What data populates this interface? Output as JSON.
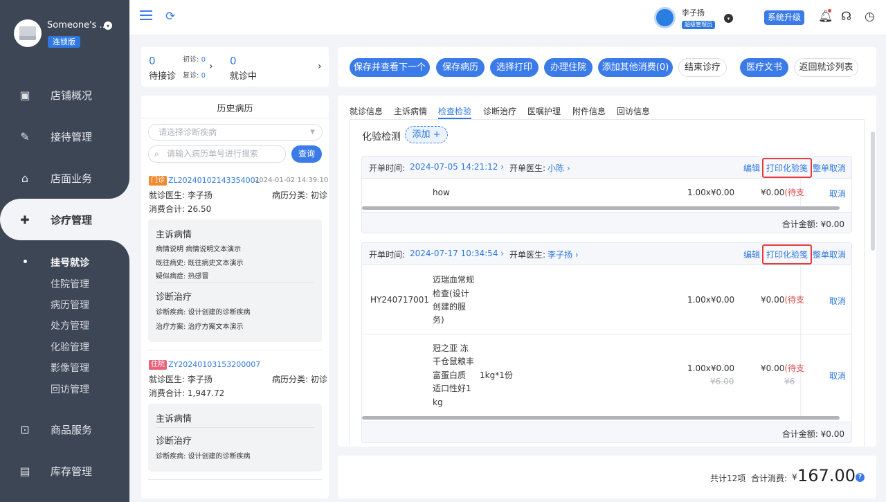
{
  "shop": {
    "name": "Someone's ...",
    "badge": "连锁版"
  },
  "nav": [
    {
      "label": "店铺概况",
      "icon": "monitor-icon"
    },
    {
      "label": "接待管理",
      "icon": "clipboard-icon"
    },
    {
      "label": "店面业务",
      "icon": "house-icon"
    },
    {
      "label": "诊疗管理",
      "icon": "medical-kit-icon"
    },
    {
      "label": "商品服务",
      "icon": "shopping-bag-icon"
    },
    {
      "label": "库存管理",
      "icon": "inventory-box-icon"
    }
  ],
  "subnav": [
    "挂号就诊",
    "住院管理",
    "病历管理",
    "处方管理",
    "化验管理",
    "影像管理",
    "回访管理"
  ],
  "topbar": {
    "user_name": "李子扬",
    "user_role": "超级管理员",
    "upgrade": "系统升级"
  },
  "stats": {
    "waiting_num": "0",
    "waiting_label": "待接诊",
    "first_label": "初诊:",
    "first_num": "0",
    "return_label": "复诊:",
    "return_num": "0",
    "in_progress_num": "0",
    "in_progress_label": "就诊中"
  },
  "history": {
    "title": "历史病历",
    "select_placeholder": "请选择诊断疾病",
    "search_placeholder": "请输入病历单号进行搜索",
    "query": "查询",
    "records": [
      {
        "tag": "门诊",
        "tag_color": "#f08b2e",
        "no": "ZL20240102143354001",
        "date": "2024-01-02 14:39:10",
        "doctor": "就诊医生: 李子扬",
        "category": "病历分类: 初诊",
        "total": "消费合计: 26.50",
        "complaint_title": "主诉病情",
        "complaint_lines": [
          "病情说明 病情说明文本演示",
          "既往病史: 既往病史文本演示",
          "疑似病症: 热感冒"
        ],
        "diag_title": "诊断治疗",
        "diag_lines": [
          "诊断疾病: 设计创建的诊断疾病",
          "治疗方案: 治疗方案文本演示"
        ]
      },
      {
        "tag": "住院",
        "tag_color": "#e8637a",
        "no": "ZY20240103153200007",
        "doctor": "就诊医生: 李子扬",
        "category": "病历分类: 初诊",
        "total": "消费合计: 1,947.72",
        "complaint_title": "主诉病情",
        "diag_title": "诊断治疗",
        "diag_lines": [
          "诊断疾病: 设计创建的诊断疾病"
        ]
      }
    ]
  },
  "actions": [
    "保存并查看下一个",
    "保存病历",
    "选择打印",
    "办理住院",
    "添加其他消费(0)",
    "结束诊疗",
    "医疗文书",
    "返回就诊列表"
  ],
  "tabs": [
    "就诊信息",
    "主诉病情",
    "检查检验",
    "诊断治疗",
    "医嘱护理",
    "附件信息",
    "回访信息"
  ],
  "section": {
    "title": "化验检测",
    "add": "添加 +"
  },
  "orders": [
    {
      "time_label": "开单时间:",
      "time": "2024-07-05 14:21:12",
      "doctor_label": "开单医生:",
      "doctor": "小陈",
      "edit": "编辑",
      "print": "打印化验笺",
      "cancel_all": "整单取消",
      "items": [
        {
          "code": "",
          "name_lines": [
            "how"
          ],
          "spec": "",
          "qty": "1.00x¥0.00",
          "price": "¥0.00",
          "status": "(待支",
          "cancel": "取消"
        }
      ],
      "total": "合计金额: ¥0.00"
    },
    {
      "time_label": "开单时间:",
      "time": "2024-07-17 10:34:54",
      "doctor_label": "开单医生:",
      "doctor": "李子扬",
      "edit": "编辑",
      "print": "打印化验笺",
      "cancel_all": "整单取消",
      "items": [
        {
          "code": "HY240717001",
          "name_lines": [
            "迈瑞血常规",
            "检查(设计",
            "创建的服",
            "务)"
          ],
          "spec": "",
          "qty": "1.00x¥0.00",
          "price": "¥0.00",
          "status": "(待支",
          "cancel": "取消"
        },
        {
          "code": "",
          "name_lines": [
            "冠之亚 冻",
            "干仓鼠粮丰",
            "富蛋白质",
            "适口性好1",
            "kg"
          ],
          "spec": "1kg*1份",
          "qty": "1.00x¥0.00",
          "qty_orig": "¥6.00",
          "price": "¥0.00",
          "price_orig": "¥6",
          "status": "(待支",
          "cancel": "取消"
        }
      ],
      "total": "合计金额: ¥0.00"
    }
  ],
  "summary": {
    "count": "共计12项",
    "label": "合计消费:",
    "currency": "¥",
    "value": "167.00"
  }
}
